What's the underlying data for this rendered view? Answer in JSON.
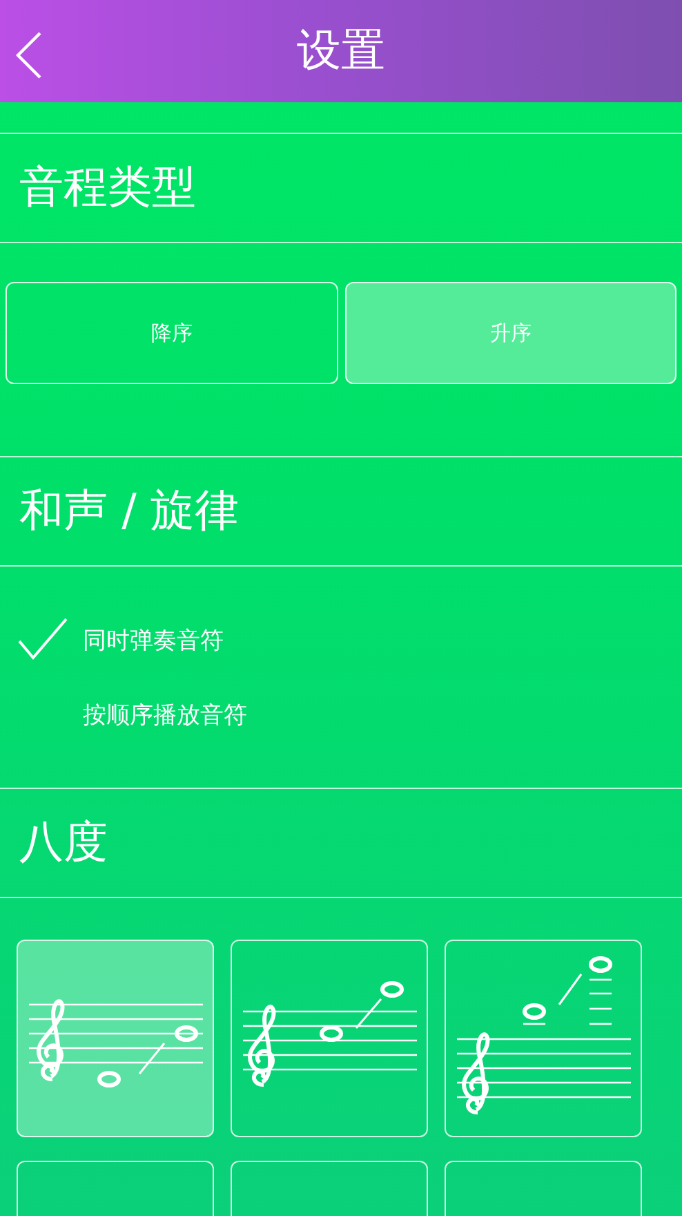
{
  "header": {
    "title": "设置"
  },
  "sections": [
    {
      "kind": "segments",
      "title": "音程类型",
      "options": [
        {
          "label": "降序",
          "selected": false
        },
        {
          "label": "升序",
          "selected": true
        }
      ]
    },
    {
      "kind": "checklist",
      "title": "和声 / 旋律",
      "options": [
        {
          "label": "同时弹奏音符",
          "selected": true
        },
        {
          "label": "按顺序播放音符",
          "selected": false
        }
      ]
    },
    {
      "kind": "tiles",
      "title": "八度",
      "options": [
        {
          "kind": "low",
          "selected": true
        },
        {
          "kind": "mid",
          "selected": false
        },
        {
          "kind": "high",
          "selected": false
        },
        {
          "kind": "blank",
          "selected": false
        },
        {
          "kind": "blank",
          "selected": false
        },
        {
          "kind": "blank",
          "selected": false
        }
      ]
    }
  ]
}
